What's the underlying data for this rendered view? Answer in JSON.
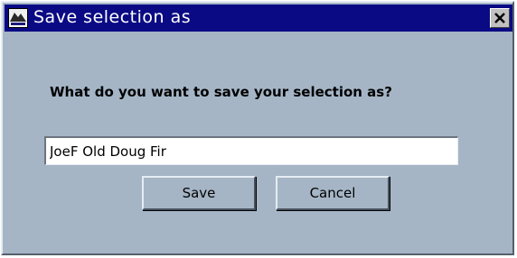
{
  "window": {
    "title": "Save selection as",
    "icon": "app-logo-icon",
    "close_icon": "close-icon"
  },
  "dialog": {
    "prompt": "What do you want to save your selection as?",
    "input_value": "JoeF Old Doug Fir"
  },
  "buttons": {
    "save_label": "Save",
    "cancel_label": "Cancel"
  },
  "colors": {
    "titlebar": "#0a0a84",
    "dialog_background": "#a5b5c6"
  }
}
